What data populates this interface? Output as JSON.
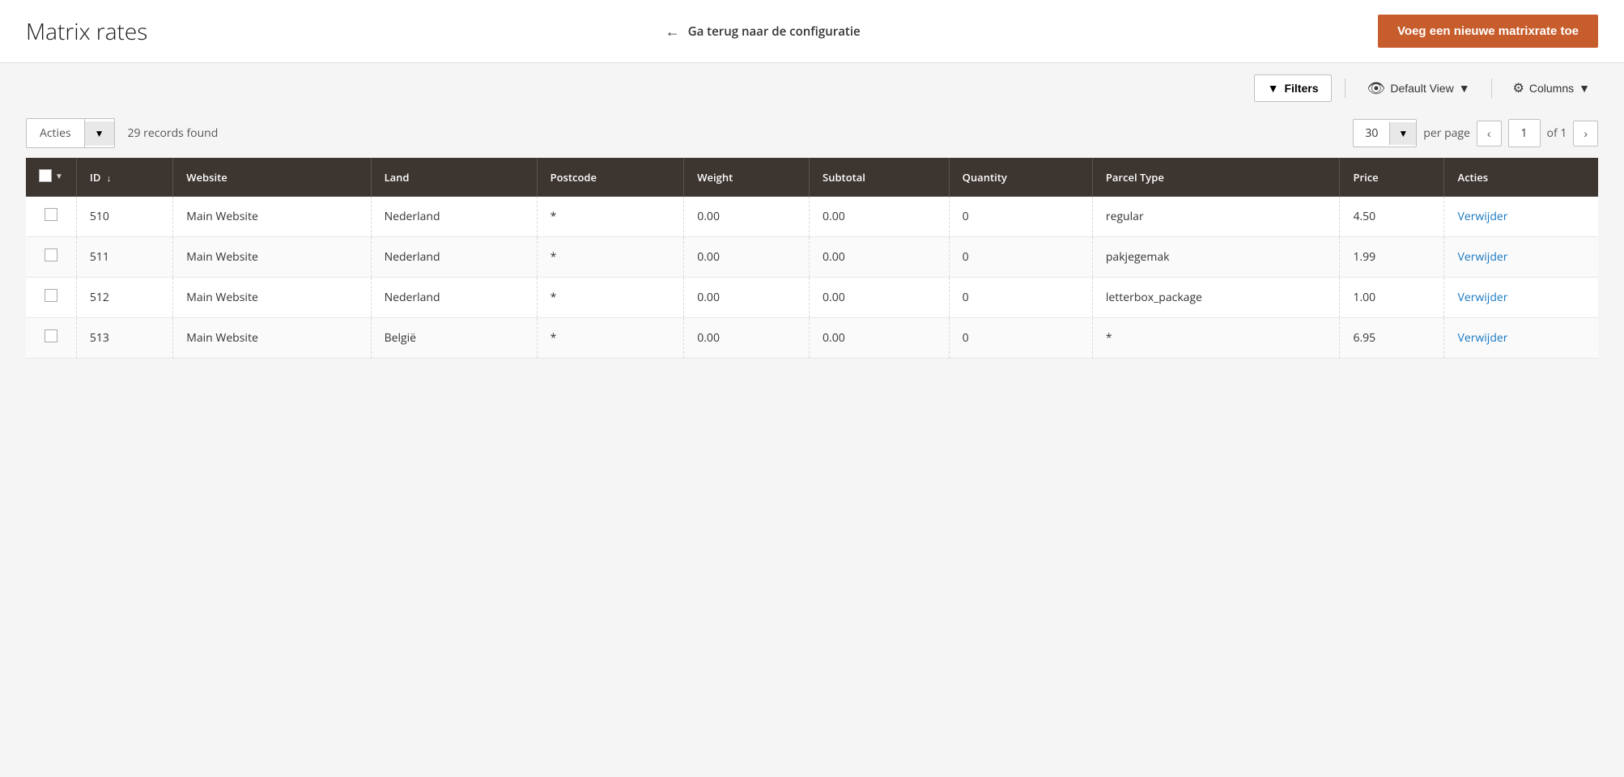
{
  "header": {
    "title": "Matrix rates",
    "back_label": "Ga terug naar de configuratie",
    "add_button_label": "Voeg een nieuwe matrixrate toe"
  },
  "toolbar": {
    "filter_button": "Filters",
    "view_label": "Default View",
    "columns_label": "Columns"
  },
  "actions": {
    "acties_label": "Acties",
    "records_found": "29 records found",
    "per_page_value": "30",
    "per_page_label": "per page",
    "current_page": "1",
    "total_pages": "of 1"
  },
  "table": {
    "columns": [
      "",
      "ID",
      "Website",
      "Land",
      "Postcode",
      "Weight",
      "Subtotal",
      "Quantity",
      "Parcel Type",
      "Price",
      "Acties"
    ],
    "rows": [
      {
        "id": "510",
        "website": "Main Website",
        "land": "Nederland",
        "postcode": "*",
        "weight": "0.00",
        "subtotal": "0.00",
        "quantity": "0",
        "parcel_type": "regular",
        "price": "4.50",
        "action": "Verwijder"
      },
      {
        "id": "511",
        "website": "Main Website",
        "land": "Nederland",
        "postcode": "*",
        "weight": "0.00",
        "subtotal": "0.00",
        "quantity": "0",
        "parcel_type": "pakjegemak",
        "price": "1.99",
        "action": "Verwijder"
      },
      {
        "id": "512",
        "website": "Main Website",
        "land": "Nederland",
        "postcode": "*",
        "weight": "0.00",
        "subtotal": "0.00",
        "quantity": "0",
        "parcel_type": "letterbox_package",
        "price": "1.00",
        "action": "Verwijder"
      },
      {
        "id": "513",
        "website": "Main Website",
        "land": "België",
        "postcode": "*",
        "weight": "0.00",
        "subtotal": "0.00",
        "quantity": "0",
        "parcel_type": "*",
        "price": "6.95",
        "action": "Verwijder"
      }
    ]
  }
}
